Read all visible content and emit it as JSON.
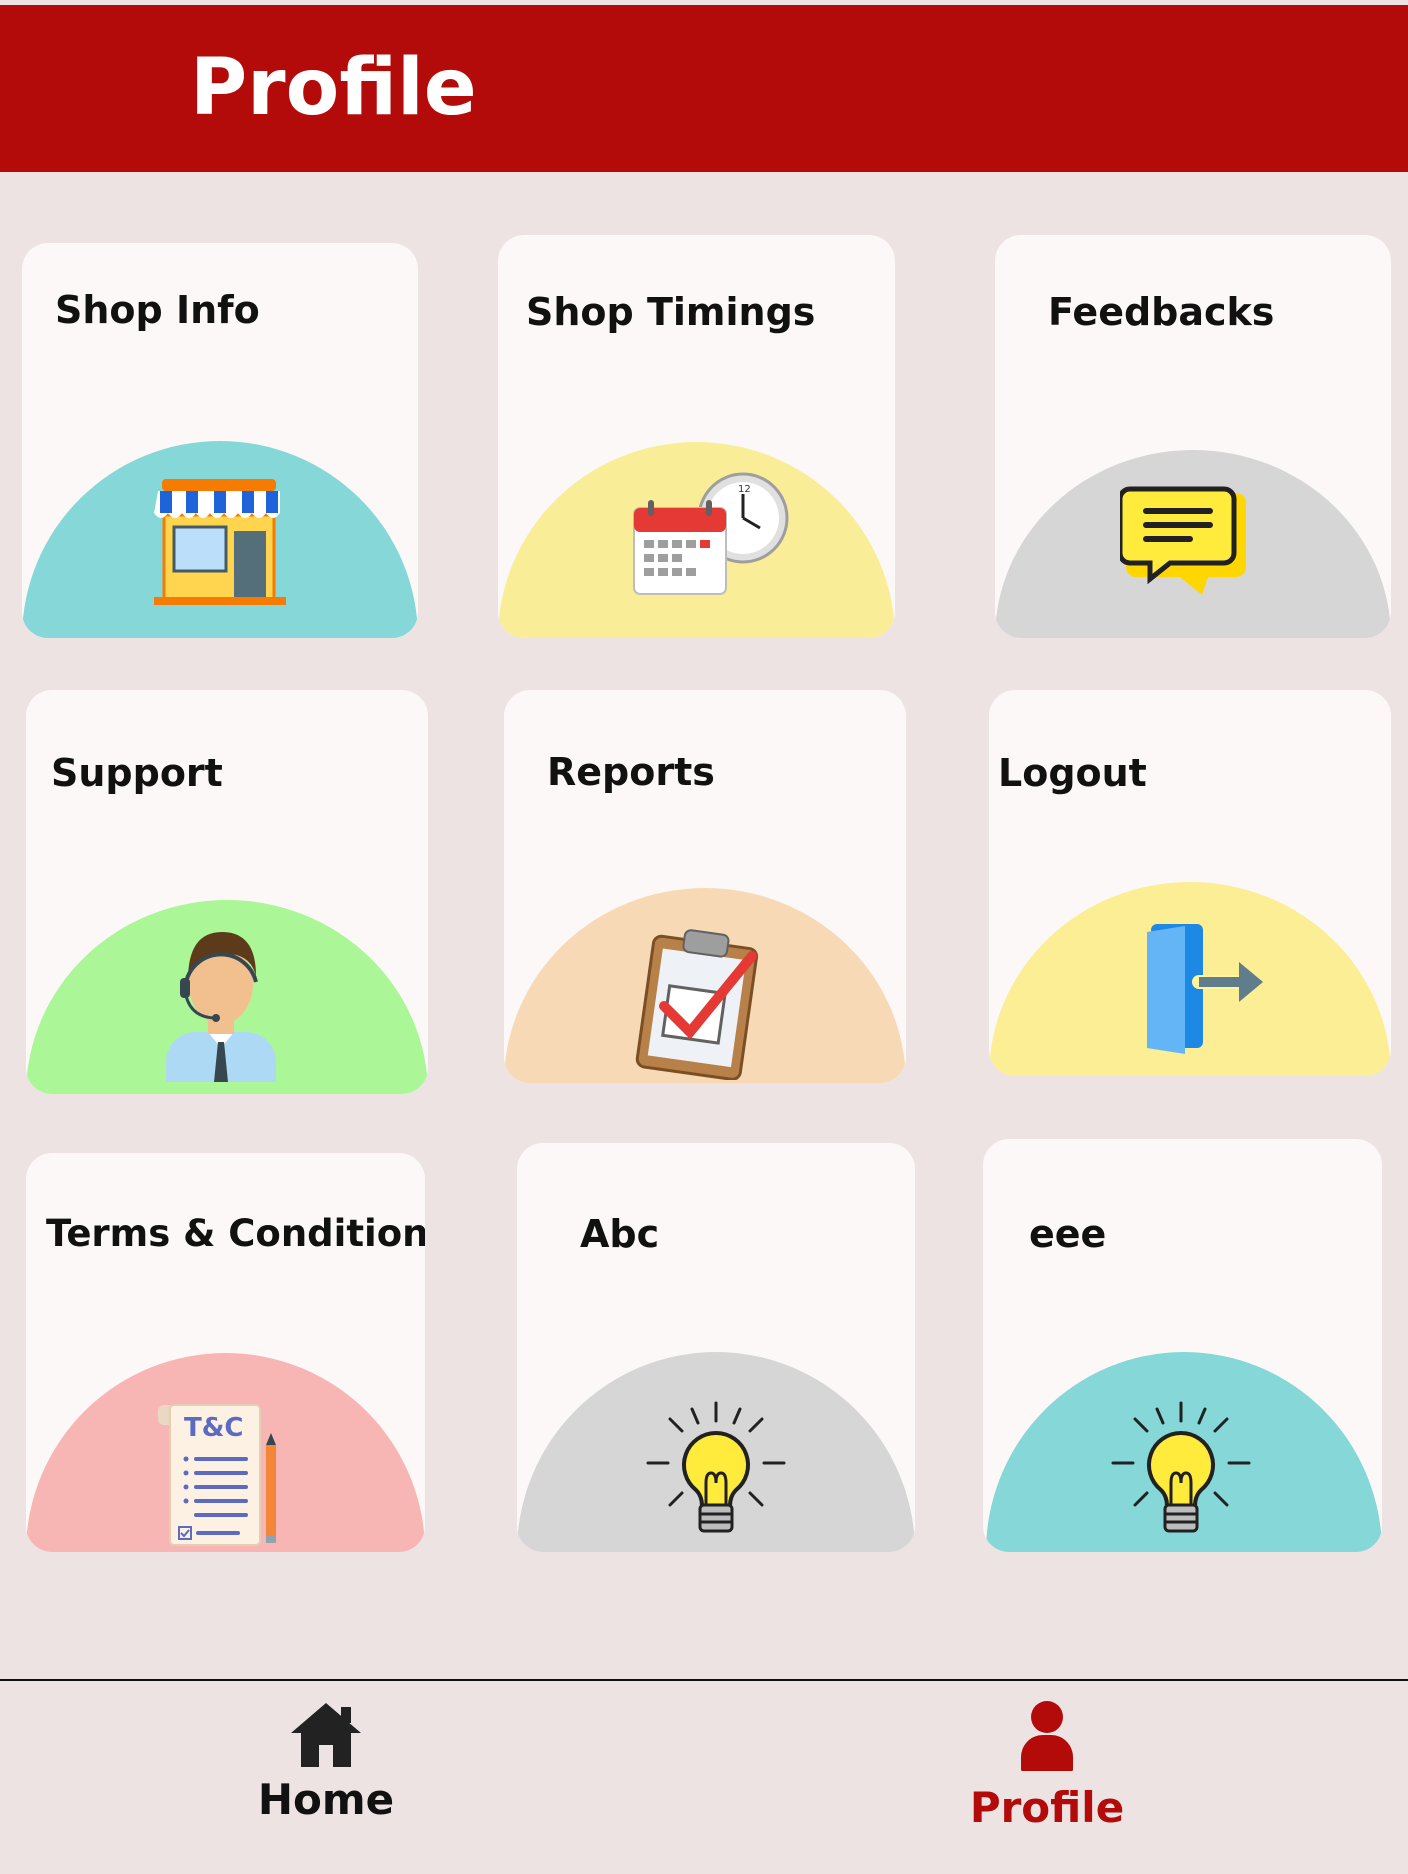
{
  "header": {
    "title": "Profile"
  },
  "cards": [
    {
      "label": "Shop Info",
      "icon": "shop-icon",
      "dome_color": "#85D7D8"
    },
    {
      "label": "Shop Timings",
      "icon": "calendar-clock-icon",
      "dome_color": "#F9EE97"
    },
    {
      "label": "Feedbacks",
      "icon": "chat-bubble-icon",
      "dome_color": "#D6D6D6"
    },
    {
      "label": "Support",
      "icon": "support-agent-icon",
      "dome_color": "#ABF797"
    },
    {
      "label": "Reports",
      "icon": "clipboard-check-icon",
      "dome_color": "#F8D9B6"
    },
    {
      "label": "Logout",
      "icon": "logout-door-icon",
      "dome_color": "#FBEE94"
    },
    {
      "label": "Terms & Condition",
      "icon": "terms-document-icon",
      "dome_color": "#F7B5B4",
      "icon_text": "T&C"
    },
    {
      "label": "Abc",
      "icon": "lightbulb-icon",
      "dome_color": "#D6D6D6"
    },
    {
      "label": "eee",
      "icon": "lightbulb-icon",
      "dome_color": "#85D7D8"
    }
  ],
  "bottom_nav": {
    "items": [
      {
        "label": "Home",
        "icon": "home-icon",
        "color": "#111111"
      },
      {
        "label": "Profile",
        "icon": "person-icon",
        "color": "#B30A0A",
        "active": true
      }
    ]
  },
  "colors": {
    "brand": "#B30A0A",
    "background": "#EDE3E3",
    "card": "#FCF8F8"
  }
}
